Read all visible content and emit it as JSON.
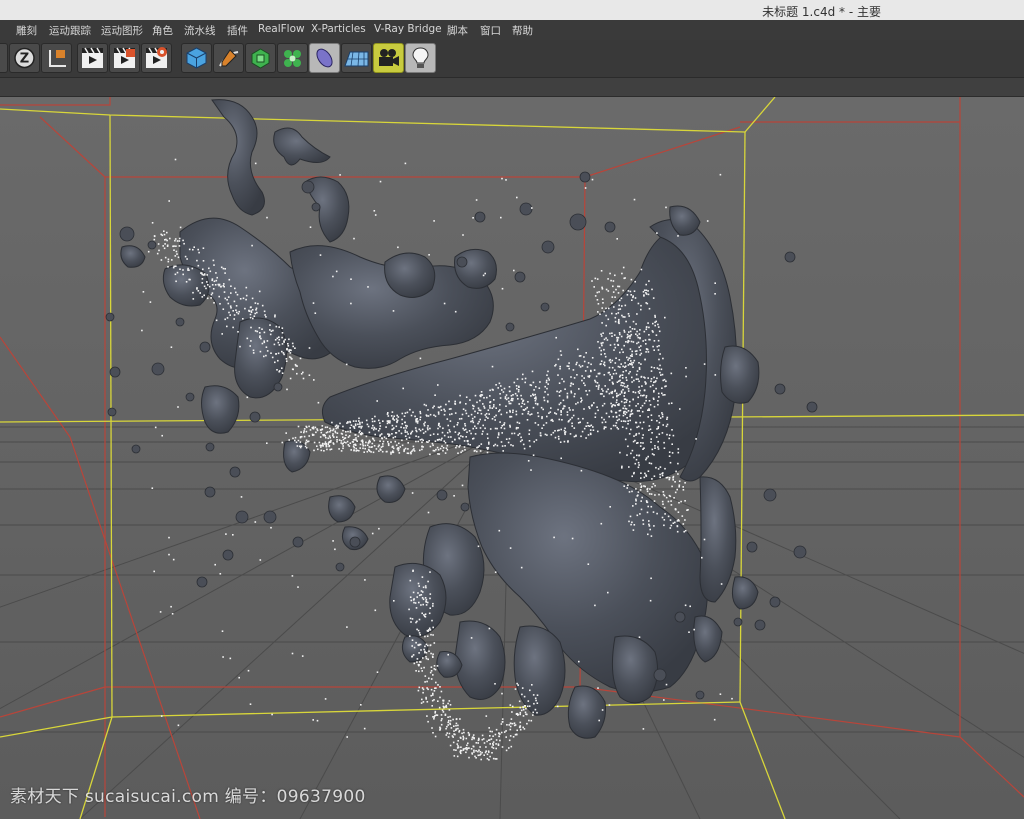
{
  "window": {
    "title": "未标题 1.c4d * - 主要"
  },
  "menu": {
    "items": [
      "雕刻",
      "运动跟踪",
      "运动图形",
      "角色",
      "流水线",
      "插件",
      "RealFlow",
      "X-Particles",
      "V-Ray Bridge",
      "脚本",
      "窗口",
      "帮助"
    ]
  },
  "toolbar": {
    "icons": [
      "z-axis-icon",
      "coordinate-axes-icon",
      "render-view-icon",
      "render-to-picture-viewer-icon",
      "render-settings-icon",
      "cube-icon",
      "pen-icon",
      "subdivision-icon",
      "cloner-icon",
      "deformer-icon",
      "floor-icon",
      "camera-icon",
      "light-icon"
    ],
    "highlight_color": "#c8cb3f"
  },
  "viewport": {
    "background_color": "#636363",
    "bounding_box_color": "#d8d63a",
    "grid_color": "#c0483c",
    "mesh_color": "#4c5059",
    "particle_color": "#f2f2f2"
  },
  "watermark": {
    "text": "素材天下 sucaisucai.com  编号：09637900"
  }
}
